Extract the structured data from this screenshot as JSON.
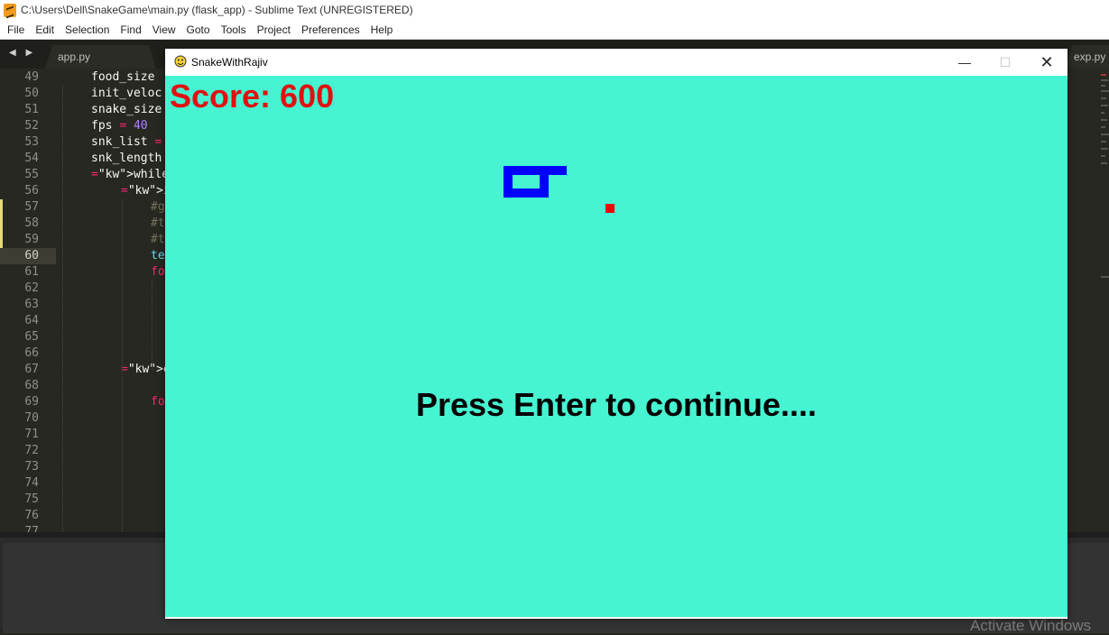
{
  "editor_window": {
    "title": "C:\\Users\\Dell\\SnakeGame\\main.py (flask_app) - Sublime Text (UNREGISTERED)",
    "menu": [
      "File",
      "Edit",
      "Selection",
      "Find",
      "View",
      "Goto",
      "Tools",
      "Project",
      "Preferences",
      "Help"
    ],
    "tabs": [
      "app.py",
      "exp.py"
    ],
    "tab_nav": "◀ ▶",
    "active_line": 60,
    "lines": [
      {
        "n": "49",
        "code": "food_size"
      },
      {
        "n": "50",
        "code": "init_veloc"
      },
      {
        "n": "51",
        "code": "snake_size"
      },
      {
        "n": "52",
        "code": "fps = 40"
      },
      {
        "n": "53",
        "code": "snk_list ="
      },
      {
        "n": "54",
        "code": "snk_length"
      },
      {
        "n": "55",
        "code": "while not"
      },
      {
        "n": "56",
        "code": "if gam"
      },
      {
        "n": "57",
        "code": "#g"
      },
      {
        "n": "58",
        "code": "#t"
      },
      {
        "n": "59",
        "code": "#t"
      },
      {
        "n": "60",
        "code": "te"
      },
      {
        "n": "61",
        "code": "fo"
      },
      {
        "n": "62",
        "code": ""
      },
      {
        "n": "63",
        "code": ""
      },
      {
        "n": "64",
        "code": ""
      },
      {
        "n": "65",
        "code": ""
      },
      {
        "n": "66",
        "code": ""
      },
      {
        "n": "67",
        "code": "else:"
      },
      {
        "n": "68",
        "code": ""
      },
      {
        "n": "69",
        "code": "fo"
      },
      {
        "n": "70",
        "code": ""
      },
      {
        "n": "71",
        "code": ""
      },
      {
        "n": "72",
        "code": ""
      },
      {
        "n": "73",
        "code": ""
      },
      {
        "n": "74",
        "code": ""
      },
      {
        "n": "75",
        "code": ""
      },
      {
        "n": "76",
        "code": ""
      },
      {
        "n": "77",
        "code": ""
      }
    ],
    "watermark": "Activate Windows"
  },
  "game_window": {
    "title": "SnakeWithRajiv",
    "buttons": {
      "minimize": "—",
      "maximize": "☐",
      "close": "✕"
    },
    "score_text": "Score: 600",
    "message": "Press Enter to continue....",
    "colors": {
      "background": "#46f4d2",
      "snake": "#0000ff",
      "food": "#ee0000",
      "score": "#e01010"
    }
  }
}
